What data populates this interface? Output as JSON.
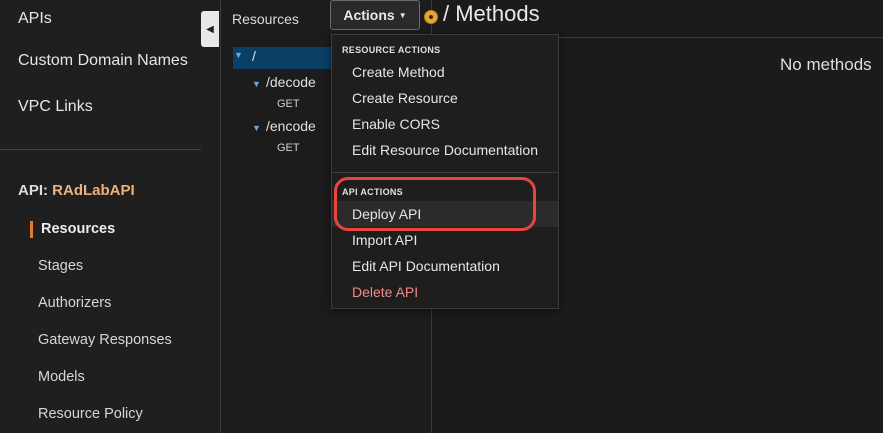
{
  "sidebar": {
    "top_items": [
      "APIs",
      "Custom Domain Names",
      "VPC Links"
    ],
    "api_prefix": "API:",
    "api_name": "RAdLabAPI",
    "sub_items": [
      "Resources",
      "Stages",
      "Authorizers",
      "Gateway Responses",
      "Models",
      "Resource Policy"
    ]
  },
  "resources": {
    "title": "Resources",
    "root": "/",
    "children": [
      {
        "path": "/decode",
        "method": "GET"
      },
      {
        "path": "/encode",
        "method": "GET"
      }
    ]
  },
  "actions": {
    "label": "Actions",
    "resource_header": "RESOURCE ACTIONS",
    "resource_items": [
      "Create Method",
      "Create Resource",
      "Enable CORS",
      "Edit Resource Documentation"
    ],
    "api_header": "API ACTIONS",
    "api_items": [
      "Deploy API",
      "Import API",
      "Edit API Documentation",
      "Delete API"
    ]
  },
  "main": {
    "title": "/ Methods",
    "empty_text": "No methods"
  },
  "colors": {
    "accent": "#e07c2f",
    "api_name": "#f0b07a",
    "selected_bg": "#0a3f66",
    "danger": "#f08a8a",
    "highlight": "#e8453c"
  }
}
